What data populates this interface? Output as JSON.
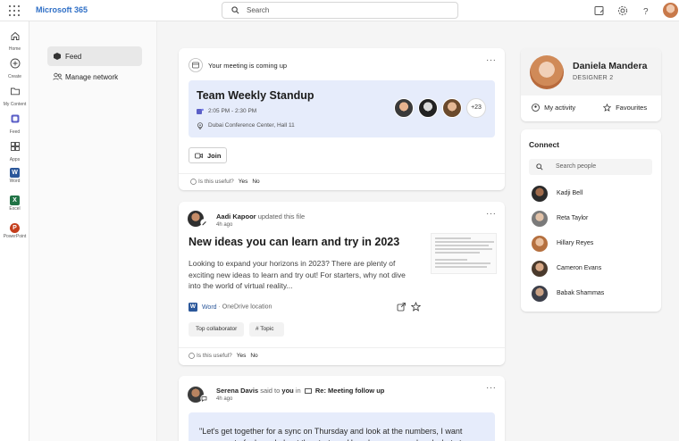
{
  "app": {
    "brand": "Microsoft 365"
  },
  "search": {
    "placeholder": "Search"
  },
  "rail": [
    {
      "label": "Home",
      "icon": "home-icon"
    },
    {
      "label": "Create",
      "icon": "create-icon"
    },
    {
      "label": "My Content",
      "icon": "folder-icon"
    },
    {
      "label": "Feed",
      "icon": "feed-icon"
    },
    {
      "label": "Apps",
      "icon": "apps-icon"
    },
    {
      "label": "Word",
      "icon": "word-icon",
      "letter": "W",
      "color": "#2b579a"
    },
    {
      "label": "Excel",
      "icon": "excel-icon",
      "letter": "X",
      "color": "#217346"
    },
    {
      "label": "PowerPoint",
      "icon": "powerpoint-icon",
      "letter": "P",
      "color": "#c43e1c"
    }
  ],
  "nav": {
    "feed": "Feed",
    "manage_network": "Manage network"
  },
  "meeting_card": {
    "header": "Your meeting is coming up",
    "title": "Team Weekly Standup",
    "time": "2:05 PM - 2:30 PM",
    "location": "Dubai Conference Center, Hall 11",
    "more_attendees": "+23",
    "join": "Join",
    "useful": "Is this useful?",
    "yes": "Yes",
    "no": "No"
  },
  "post_card": {
    "author": "Aadi Kapoor",
    "action": "updated this file",
    "time": "4h ago",
    "title": "New ideas you can learn and try in 2023",
    "body": "Looking to expand your horizons in 2023? There are plenty of exciting new ideas to learn and try out! For starters, why not dive into the world of virtual reality...",
    "app": "Word",
    "location": "OneDrive location",
    "chip_collaborator": "Top collaborator",
    "chip_topic": "# Topic",
    "useful": "Is this useful?",
    "yes": "Yes",
    "no": "No"
  },
  "mail_card": {
    "author": "Serena Davis",
    "said_to": "said to",
    "you": "you",
    "in": "in",
    "subject": "Re: Meeting follow up",
    "time": "4h ago",
    "quote": "\"Let's get together for a sync on Thursday and look at the numbers, I want everyone to feel good about the strategy. How do we proceed and what steps"
  },
  "profile": {
    "name": "Daniela Mandera",
    "role": "DESIGNER 2",
    "my_activity": "My activity",
    "favourites": "Favourites"
  },
  "connect": {
    "title": "Connect",
    "search_placeholder": "Search people",
    "people": [
      {
        "name": "Kadji Bell"
      },
      {
        "name": "Reta Taylor"
      },
      {
        "name": "Hillary Reyes"
      },
      {
        "name": "Cameron Evans"
      },
      {
        "name": "Babak Shammas"
      }
    ]
  }
}
